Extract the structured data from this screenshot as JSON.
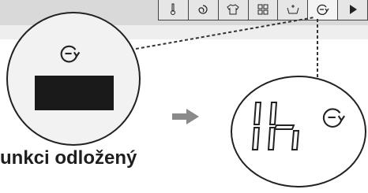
{
  "panel": {
    "buttons": [
      {
        "icon": "thermometer-icon",
        "glyph": "🌡"
      },
      {
        "icon": "spin-icon",
        "glyph": "@"
      },
      {
        "icon": "shirt-icon",
        "glyph": "👕"
      },
      {
        "icon": "grid-icon",
        "glyph": "▯▯"
      },
      {
        "icon": "basin-icon",
        "glyph": "⊔"
      },
      {
        "icon": "delay-timer-icon",
        "glyph": "⊖"
      },
      {
        "icon": "play-icon",
        "glyph": "▶"
      }
    ],
    "selected_index": 5
  },
  "display_left": {
    "icon": "delay-timer-icon"
  },
  "display_right": {
    "value": "1h",
    "icon": "delay-timer-icon"
  },
  "caption": "unkci odložený",
  "colors": {
    "dark": "#1a1a1a",
    "panel": "#d9d9d9"
  }
}
